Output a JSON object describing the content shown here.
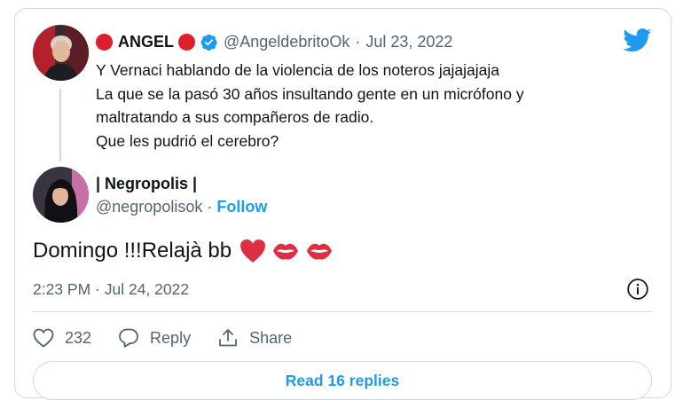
{
  "quoted_tweet": {
    "display_name": "ANGEL",
    "handle": "@AngeldebritoOk",
    "date_separator": "·",
    "date": "Jul 23, 2022",
    "lines": [
      "Y Vernaci hablando de la violencia de los noteros jajajajaja",
      "La que se la pasó 30 años insultando gente en un micrófono y",
      "maltratando a sus compañeros de radio.",
      "Que les pudrió el cerebro?"
    ],
    "badge_color": "#1d9bf0",
    "dot_color": "#dd1f2b"
  },
  "reply": {
    "display_name": "| Negropolis |",
    "handle": "@negropolisok",
    "separator": "·",
    "follow_label": "Follow",
    "text": "Domingo !!!Relajà bb",
    "emojis": [
      "red-heart-icon",
      "kiss-mark-icon",
      "kiss-mark-icon"
    ],
    "time": "2:23 PM · Jul 24, 2022"
  },
  "actions": {
    "likes": "232",
    "reply_label": "Reply",
    "share_label": "Share"
  },
  "read_replies_label": "Read 16 replies",
  "brand": {
    "logo": "twitter-bird-icon",
    "color": "#1d9bf0"
  }
}
